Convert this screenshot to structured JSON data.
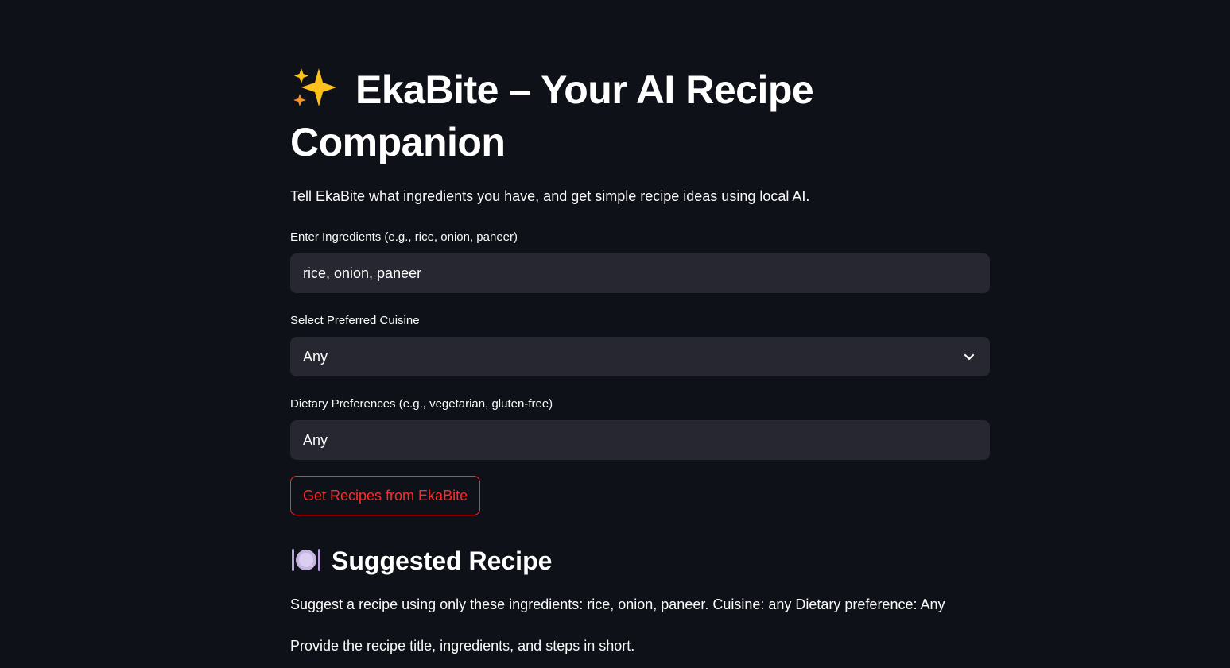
{
  "header": {
    "title_icon": "sparkles-icon",
    "title": "EkaBite – Your AI Recipe Companion",
    "subtitle": "Tell EkaBite what ingredients you have, and get simple recipe ideas using local AI."
  },
  "form": {
    "ingredients": {
      "label": "Enter Ingredients (e.g., rice, onion, paneer)",
      "value": "rice, onion, paneer"
    },
    "cuisine": {
      "label": "Select Preferred Cuisine",
      "selected": "Any",
      "icon": "chevron-down-icon"
    },
    "dietary": {
      "label": "Dietary Preferences (e.g., vegetarian, gluten-free)",
      "value": "Any"
    },
    "submit_label": "Get Recipes from EkaBite"
  },
  "result": {
    "heading_icon": "plate-with-cutlery-icon",
    "heading": "Suggested Recipe",
    "line1": "Suggest a recipe using only these ingredients: rice, onion, paneer. Cuisine: any Dietary preference: Any",
    "line2": "Provide the recipe title, ingredients, and steps in short."
  },
  "colors": {
    "background": "#0e1117",
    "input_background": "#262730",
    "accent": "#ff2b2b",
    "text": "#fafafa"
  }
}
